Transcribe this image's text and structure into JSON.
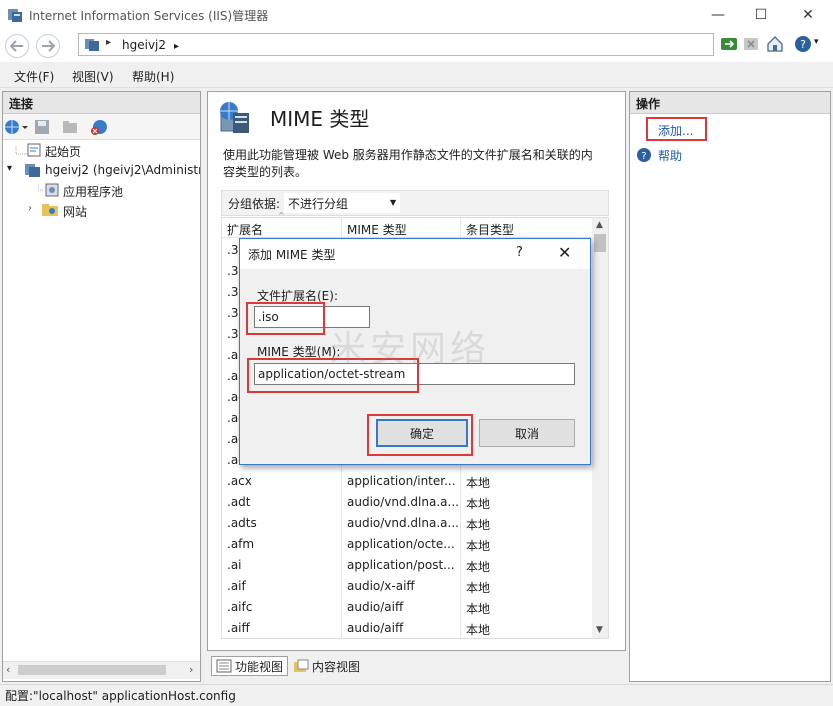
{
  "window": {
    "title": "Internet Information Services (IIS)管理器",
    "minimize": "—",
    "maximize": "☐",
    "close": "✕"
  },
  "address": {
    "breadcrumb_sep": "▸",
    "crumb": "hgeivj2",
    "crumb_sep": "▸"
  },
  "menu": [
    "文件(F)",
    "视图(V)",
    "帮助(H)"
  ],
  "left": {
    "header": "连接",
    "tree": [
      {
        "label": "起始页"
      },
      {
        "label": "hgeivj2 (hgeivj2\\Administra"
      },
      {
        "label": "应用程序池"
      },
      {
        "label": "网站"
      }
    ],
    "scroll_left": "‹",
    "scroll_right": "›"
  },
  "center": {
    "title": "MIME 类型",
    "description": "使用此功能管理被 Web 服务器用作静态文件的文件扩展名和关联的内容类型的列表。",
    "group_label": "分组依据:",
    "group_value": "不进行分组",
    "columns": [
      "扩展名",
      "MIME 类型",
      "条目类型"
    ],
    "rows": [
      {
        "ext": ".3g",
        "mime": "",
        "type": ""
      },
      {
        "ext": ".3g",
        "mime": "",
        "type": ""
      },
      {
        "ext": ".3g",
        "mime": "",
        "type": ""
      },
      {
        "ext": ".3g",
        "mime": "",
        "type": ""
      },
      {
        "ext": ".3g",
        "mime": "",
        "type": ""
      },
      {
        "ext": ".aa",
        "mime": "",
        "type": ""
      },
      {
        "ext": ".aa",
        "mime": "",
        "type": ""
      },
      {
        "ext": ".ac",
        "mime": "",
        "type": ""
      },
      {
        "ext": ".ac",
        "mime": "",
        "type": ""
      },
      {
        "ext": ".ac",
        "mime": "",
        "type": ""
      },
      {
        "ext": ".ac",
        "mime": "",
        "type": ""
      },
      {
        "ext": ".acx",
        "mime": "application/inter...",
        "type": "本地"
      },
      {
        "ext": ".adt",
        "mime": "audio/vnd.dlna.a...",
        "type": "本地"
      },
      {
        "ext": ".adts",
        "mime": "audio/vnd.dlna.a...",
        "type": "本地"
      },
      {
        "ext": ".afm",
        "mime": "application/octe...",
        "type": "本地"
      },
      {
        "ext": ".ai",
        "mime": "application/post...",
        "type": "本地"
      },
      {
        "ext": ".aif",
        "mime": "audio/x-aiff",
        "type": "本地"
      },
      {
        "ext": ".aifc",
        "mime": "audio/aiff",
        "type": "本地"
      },
      {
        "ext": ".aiff",
        "mime": "audio/aiff",
        "type": "本地"
      }
    ],
    "tabs": [
      "功能视图",
      "内容视图"
    ]
  },
  "right": {
    "header": "操作",
    "actions": [
      "添加...",
      "帮助"
    ]
  },
  "status": "配置:\"localhost\" applicationHost.config",
  "dialog": {
    "title": "添加 MIME 类型",
    "help": "?",
    "close": "✕",
    "ext_label": "文件扩展名(E):",
    "ext_value": ".iso",
    "mime_label": "MIME 类型(M):",
    "mime_value": "application/octet-stream",
    "ok": "确定",
    "cancel": "取消"
  },
  "watermark": "米安网络",
  "colors": {
    "highlight_box": "#d9393a",
    "link": "#1e5aa8",
    "dialog_border": "#3b78c4"
  }
}
